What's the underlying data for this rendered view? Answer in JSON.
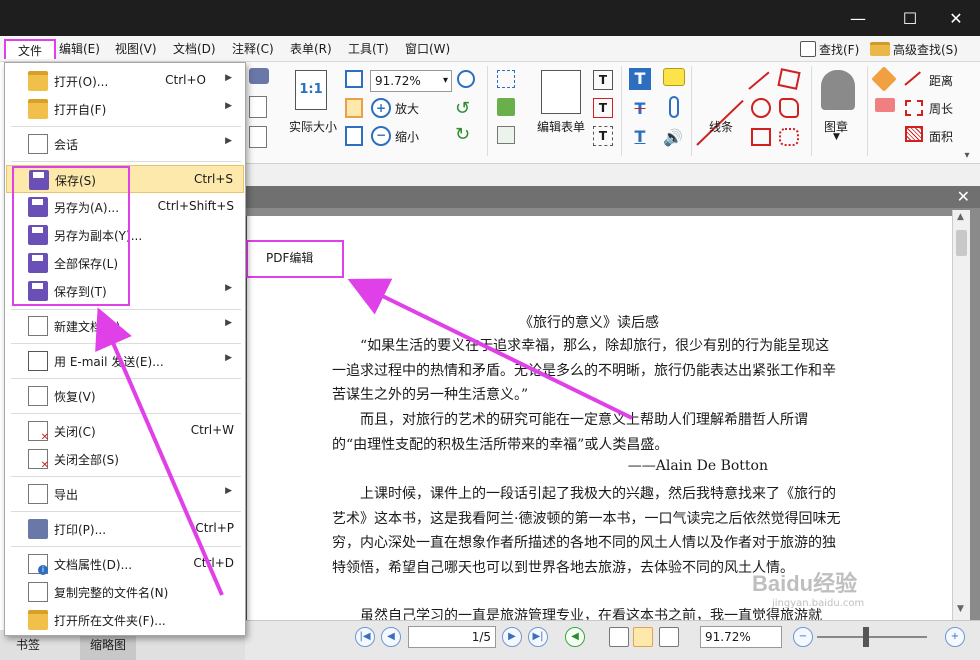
{
  "colors": {
    "highlight": "#e040e8",
    "menu_hover": "#fde9ab",
    "accent_blue": "#2c6fc0",
    "accent_red": "#d02020"
  },
  "window": {
    "minimize": "—",
    "maximize": "☐",
    "close": "✕"
  },
  "menubar": {
    "items": [
      "文件",
      "编辑(E)",
      "视图(V)",
      "文档(D)",
      "注释(C)",
      "表单(R)",
      "工具(T)",
      "窗口(W)"
    ],
    "find": "查找(F)",
    "advanced_find": "高级查找(S)"
  },
  "ribbon": {
    "zoom_value": "91.72%",
    "actual_size_label": "实际大小",
    "actual_size_icon_text": "1:1",
    "zoom_in_label": "放大",
    "zoom_out_label": "缩小",
    "edit_form_label": "编辑表单",
    "lines_label": "线条",
    "stamp_label": "图章",
    "distance_label": "距离",
    "perimeter_label": "周长",
    "area_label": "面积",
    "text_T": "T"
  },
  "file_menu": {
    "items": [
      {
        "label": "打开(O)...",
        "shortcut": "Ctrl+O",
        "arrow": "▶"
      },
      {
        "label": "打开自(F)",
        "shortcut": "",
        "arrow": "▶"
      },
      {
        "label": "会话",
        "shortcut": "",
        "arrow": "▶"
      },
      {
        "label": "保存(S)",
        "shortcut": "Ctrl+S",
        "arrow": ""
      },
      {
        "label": "另存为(A)...",
        "shortcut": "Ctrl+Shift+S",
        "arrow": ""
      },
      {
        "label": "另存为副本(Y)...",
        "shortcut": "",
        "arrow": ""
      },
      {
        "label": "全部保存(L)",
        "shortcut": "",
        "arrow": ""
      },
      {
        "label": "保存到(T)",
        "shortcut": "",
        "arrow": "▶"
      },
      {
        "label": "新建文档(N)",
        "shortcut": "",
        "arrow": "▶"
      },
      {
        "label": "用 E-mail 发送(E)...",
        "shortcut": "",
        "arrow": "▶"
      },
      {
        "label": "恢复(V)",
        "shortcut": "",
        "arrow": ""
      },
      {
        "label": "关闭(C)",
        "shortcut": "Ctrl+W",
        "arrow": ""
      },
      {
        "label": "关闭全部(S)",
        "shortcut": "",
        "arrow": ""
      },
      {
        "label": "导出",
        "shortcut": "",
        "arrow": "▶"
      },
      {
        "label": "打印(P)...",
        "shortcut": "Ctrl+P",
        "arrow": ""
      },
      {
        "label": "文档属性(D)...",
        "shortcut": "Ctrl+D",
        "arrow": ""
      },
      {
        "label": "复制完整的文件名(N)",
        "shortcut": "",
        "arrow": ""
      },
      {
        "label": "打开所在文件夹(F)...",
        "shortcut": "",
        "arrow": ""
      }
    ]
  },
  "document": {
    "annotation_text": "PDF编辑",
    "title": "《旅行的意义》读后感",
    "p1": "“如果生活的要义在于追求幸福，那么，除却旅行，很少有别的行为能呈现这一追求过程中的热情和矛盾。无论是多么的不明晰，旅行仍能表达出紧张工作和辛苦谋生之外的另一种生活意义。”",
    "p2": "而且，对旅行的艺术的研究可能在一定意义上帮助人们理解希腊哲人所谓的“由理性支配的积极生活所带来的幸福”或人类昌盛。",
    "signature": "——Alain De Botton",
    "p3": "上课时候，课件上的一段话引起了我极大的兴趣，然后我特意找来了《旅行的艺术》这本书，这是我看阿兰·德波顿的第一本书，一口气读完之后依然觉得回味无穷，内心深处一直在想象作者所描述的各地不同的风土人情以及作者对于旅游的独特领悟，希望自己哪天也可以到世界各地去旅游，去体验不同的风土人情。",
    "p4": "虽然自己学习的一直是旅游管理专业，在看这本书之前，我一直觉得旅游就"
  },
  "statusbar": {
    "page": "1/5",
    "zoom": "91.72%"
  },
  "bottom_tabs": [
    "书签",
    "缩略图"
  ],
  "watermark": {
    "text": "Baidu经验",
    "sub": "jingyan.baidu.com"
  }
}
